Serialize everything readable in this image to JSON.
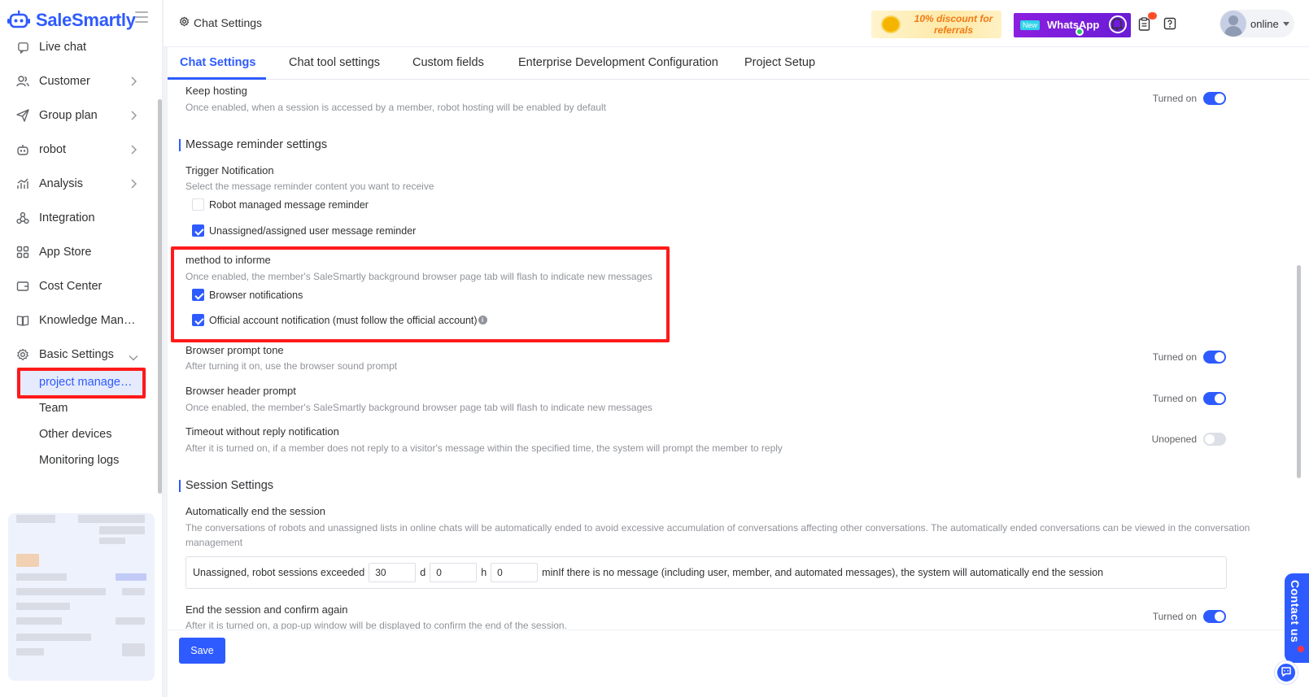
{
  "brand": {
    "name": "SaleSmartly",
    "accent": "#2e5bff",
    "annotation_color": "#ff1a1a"
  },
  "sidebar": {
    "items": [
      {
        "label": "Live chat",
        "icon": "chat-icon"
      },
      {
        "label": "Customer",
        "icon": "people-icon"
      },
      {
        "label": "Group plan",
        "icon": "send-icon"
      },
      {
        "label": "robot",
        "icon": "robot-icon"
      },
      {
        "label": "Analysis",
        "icon": "chart-icon"
      },
      {
        "label": "Integration",
        "icon": "integration-icon"
      },
      {
        "label": "App Store",
        "icon": "apps-icon"
      },
      {
        "label": "Cost Center",
        "icon": "wallet-icon"
      },
      {
        "label": "Knowledge Man…",
        "icon": "book-icon"
      },
      {
        "label": "Basic Settings",
        "icon": "gear-icon"
      }
    ],
    "sub_items": [
      {
        "label": "project managem…",
        "active": true
      },
      {
        "label": "Team",
        "active": false
      },
      {
        "label": "Other devices",
        "active": false
      },
      {
        "label": "Monitoring logs",
        "active": false
      }
    ]
  },
  "header": {
    "title": "Chat Settings",
    "promo_referral": "10% discount for referrals",
    "promo_whatsapp_badge": "New",
    "promo_whatsapp": "WhatsApp",
    "user_status": "online"
  },
  "tabs": [
    "Chat Settings",
    "Chat tool settings",
    "Custom fields",
    "Enterprise Development Configuration",
    "Project Setup"
  ],
  "settings": {
    "keep_hosting": {
      "title": "Keep hosting",
      "desc": "Once enabled, when a session is accessed by a member, robot hosting will be enabled by default",
      "state_label": "Turned on"
    },
    "message_reminder_heading": "Message reminder settings",
    "trigger_notification": {
      "title": "Trigger Notification",
      "desc": "Select the message reminder content you want to receive",
      "options": [
        {
          "label": "Robot managed message reminder",
          "checked": false
        },
        {
          "label": "Unassigned/assigned user message reminder",
          "checked": true
        }
      ]
    },
    "method_to_inform": {
      "title": "method to informe",
      "desc": "Once enabled, the member's SaleSmartly background browser page tab will flash to indicate new messages",
      "options": [
        {
          "label": "Browser notifications",
          "checked": true
        },
        {
          "label": "Official account notification (must follow the official account)",
          "checked": true
        }
      ]
    },
    "browser_prompt_tone": {
      "title": "Browser prompt tone",
      "desc": "After turning it on, use the browser sound prompt",
      "state_label": "Turned on"
    },
    "browser_header_prompt": {
      "title": "Browser header prompt",
      "desc": "Once enabled, the member's SaleSmartly background browser page tab will flash to indicate new messages",
      "state_label": "Turned on"
    },
    "timeout_notification": {
      "title": "Timeout without reply notification",
      "desc": "After it is turned on, if a member does not reply to a visitor's message within the specified time, the system will prompt the member to reply",
      "state_label": "Unopened"
    },
    "session_heading": "Session Settings",
    "auto_end": {
      "title": "Automatically end the session",
      "desc_line1": "The conversations of robots and unassigned lists in online chats will be automatically ended to avoid excessive accumulation of conversations affecting other conversations. The automatically ended conversations can be viewed in the conversation",
      "desc_line2": "management",
      "prefix": "Unassigned, robot sessions exceeded",
      "days": "30",
      "days_unit": "d",
      "hours": "0",
      "hours_unit": "h",
      "minutes": "0",
      "suffix": "minIf there is no message (including user, member, and automated messages), the system will automatically end the session"
    },
    "end_confirm": {
      "title": "End the session and confirm again",
      "desc": "After it is turned on, a pop-up window will be displayed to confirm the end of the session.",
      "state_label": "Turned on"
    }
  },
  "save_label": "Save",
  "contact_us": "Contact us"
}
